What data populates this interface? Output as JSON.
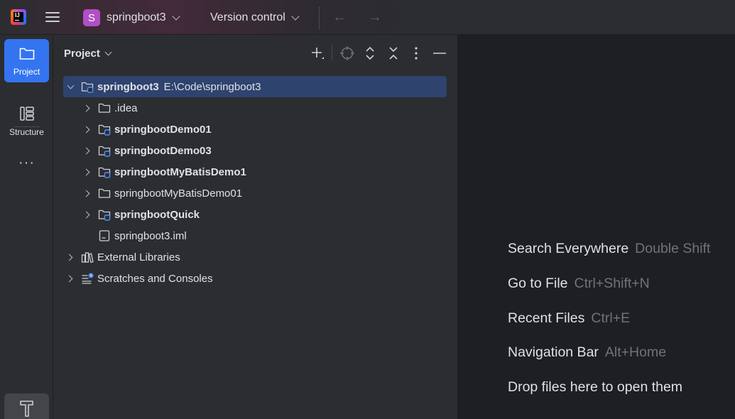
{
  "titlebar": {
    "project_badge": "S",
    "project_name": "springboot3",
    "vcs_label": "Version control",
    "back_arrow": "←",
    "forward_arrow": "→"
  },
  "toolstrip": {
    "project_label": "Project",
    "structure_label": "Structure",
    "more_label": "···"
  },
  "panel": {
    "title": "Project",
    "tree": [
      {
        "name": "springboot3",
        "path": "E:\\Code\\springboot3",
        "bold": true,
        "indent": 0,
        "expander": "down",
        "icon": "module-folder-icon",
        "selected": true
      },
      {
        "name": ".idea",
        "path": "",
        "bold": false,
        "indent": 1,
        "expander": "right",
        "icon": "folder-icon",
        "selected": false
      },
      {
        "name": "springbootDemo01",
        "path": "",
        "bold": true,
        "indent": 1,
        "expander": "right",
        "icon": "module-folder-icon",
        "selected": false
      },
      {
        "name": "springbootDemo03",
        "path": "",
        "bold": true,
        "indent": 1,
        "expander": "right",
        "icon": "module-folder-icon",
        "selected": false
      },
      {
        "name": "springbootMyBatisDemo1",
        "path": "",
        "bold": true,
        "indent": 1,
        "expander": "right",
        "icon": "module-folder-icon",
        "selected": false
      },
      {
        "name": "springbootMyBatisDemo01",
        "path": "",
        "bold": false,
        "indent": 1,
        "expander": "right",
        "icon": "folder-icon",
        "selected": false
      },
      {
        "name": "springbootQuick",
        "path": "",
        "bold": true,
        "indent": 1,
        "expander": "right",
        "icon": "module-folder-icon",
        "selected": false
      },
      {
        "name": "springboot3.iml",
        "path": "",
        "bold": false,
        "indent": 1,
        "expander": "none",
        "icon": "iml-file-icon",
        "selected": false
      },
      {
        "name": "External Libraries",
        "path": "",
        "bold": false,
        "indent": 0,
        "expander": "right",
        "icon": "libraries-icon",
        "selected": false
      },
      {
        "name": "Scratches and Consoles",
        "path": "",
        "bold": false,
        "indent": 0,
        "expander": "right",
        "icon": "scratches-icon",
        "selected": false
      }
    ]
  },
  "editor": {
    "hints": [
      {
        "label": "Search Everywhere",
        "key": "Double Shift"
      },
      {
        "label": "Go to File",
        "key": "Ctrl+Shift+N"
      },
      {
        "label": "Recent Files",
        "key": "Ctrl+E"
      },
      {
        "label": "Navigation Bar",
        "key": "Alt+Home"
      },
      {
        "label": "Drop files here to open them",
        "key": ""
      }
    ]
  }
}
